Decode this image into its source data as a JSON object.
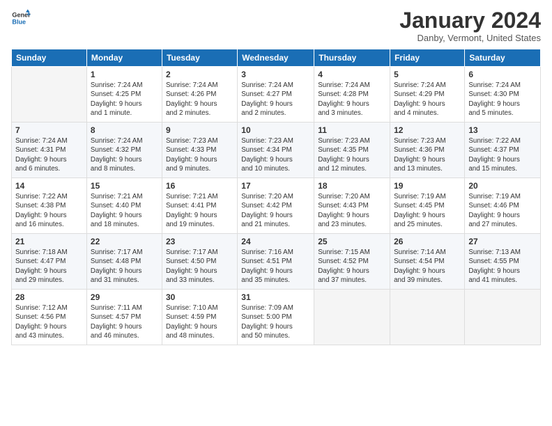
{
  "header": {
    "logo_line1": "General",
    "logo_line2": "Blue",
    "month_title": "January 2024",
    "location": "Danby, Vermont, United States"
  },
  "weekdays": [
    "Sunday",
    "Monday",
    "Tuesday",
    "Wednesday",
    "Thursday",
    "Friday",
    "Saturday"
  ],
  "rows": [
    [
      {
        "day": "",
        "text": ""
      },
      {
        "day": "1",
        "text": "Sunrise: 7:24 AM\nSunset: 4:25 PM\nDaylight: 9 hours\nand 1 minute."
      },
      {
        "day": "2",
        "text": "Sunrise: 7:24 AM\nSunset: 4:26 PM\nDaylight: 9 hours\nand 2 minutes."
      },
      {
        "day": "3",
        "text": "Sunrise: 7:24 AM\nSunset: 4:27 PM\nDaylight: 9 hours\nand 2 minutes."
      },
      {
        "day": "4",
        "text": "Sunrise: 7:24 AM\nSunset: 4:28 PM\nDaylight: 9 hours\nand 3 minutes."
      },
      {
        "day": "5",
        "text": "Sunrise: 7:24 AM\nSunset: 4:29 PM\nDaylight: 9 hours\nand 4 minutes."
      },
      {
        "day": "6",
        "text": "Sunrise: 7:24 AM\nSunset: 4:30 PM\nDaylight: 9 hours\nand 5 minutes."
      }
    ],
    [
      {
        "day": "7",
        "text": "Sunrise: 7:24 AM\nSunset: 4:31 PM\nDaylight: 9 hours\nand 6 minutes."
      },
      {
        "day": "8",
        "text": "Sunrise: 7:24 AM\nSunset: 4:32 PM\nDaylight: 9 hours\nand 8 minutes."
      },
      {
        "day": "9",
        "text": "Sunrise: 7:23 AM\nSunset: 4:33 PM\nDaylight: 9 hours\nand 9 minutes."
      },
      {
        "day": "10",
        "text": "Sunrise: 7:23 AM\nSunset: 4:34 PM\nDaylight: 9 hours\nand 10 minutes."
      },
      {
        "day": "11",
        "text": "Sunrise: 7:23 AM\nSunset: 4:35 PM\nDaylight: 9 hours\nand 12 minutes."
      },
      {
        "day": "12",
        "text": "Sunrise: 7:23 AM\nSunset: 4:36 PM\nDaylight: 9 hours\nand 13 minutes."
      },
      {
        "day": "13",
        "text": "Sunrise: 7:22 AM\nSunset: 4:37 PM\nDaylight: 9 hours\nand 15 minutes."
      }
    ],
    [
      {
        "day": "14",
        "text": "Sunrise: 7:22 AM\nSunset: 4:38 PM\nDaylight: 9 hours\nand 16 minutes."
      },
      {
        "day": "15",
        "text": "Sunrise: 7:21 AM\nSunset: 4:40 PM\nDaylight: 9 hours\nand 18 minutes."
      },
      {
        "day": "16",
        "text": "Sunrise: 7:21 AM\nSunset: 4:41 PM\nDaylight: 9 hours\nand 19 minutes."
      },
      {
        "day": "17",
        "text": "Sunrise: 7:20 AM\nSunset: 4:42 PM\nDaylight: 9 hours\nand 21 minutes."
      },
      {
        "day": "18",
        "text": "Sunrise: 7:20 AM\nSunset: 4:43 PM\nDaylight: 9 hours\nand 23 minutes."
      },
      {
        "day": "19",
        "text": "Sunrise: 7:19 AM\nSunset: 4:45 PM\nDaylight: 9 hours\nand 25 minutes."
      },
      {
        "day": "20",
        "text": "Sunrise: 7:19 AM\nSunset: 4:46 PM\nDaylight: 9 hours\nand 27 minutes."
      }
    ],
    [
      {
        "day": "21",
        "text": "Sunrise: 7:18 AM\nSunset: 4:47 PM\nDaylight: 9 hours\nand 29 minutes."
      },
      {
        "day": "22",
        "text": "Sunrise: 7:17 AM\nSunset: 4:48 PM\nDaylight: 9 hours\nand 31 minutes."
      },
      {
        "day": "23",
        "text": "Sunrise: 7:17 AM\nSunset: 4:50 PM\nDaylight: 9 hours\nand 33 minutes."
      },
      {
        "day": "24",
        "text": "Sunrise: 7:16 AM\nSunset: 4:51 PM\nDaylight: 9 hours\nand 35 minutes."
      },
      {
        "day": "25",
        "text": "Sunrise: 7:15 AM\nSunset: 4:52 PM\nDaylight: 9 hours\nand 37 minutes."
      },
      {
        "day": "26",
        "text": "Sunrise: 7:14 AM\nSunset: 4:54 PM\nDaylight: 9 hours\nand 39 minutes."
      },
      {
        "day": "27",
        "text": "Sunrise: 7:13 AM\nSunset: 4:55 PM\nDaylight: 9 hours\nand 41 minutes."
      }
    ],
    [
      {
        "day": "28",
        "text": "Sunrise: 7:12 AM\nSunset: 4:56 PM\nDaylight: 9 hours\nand 43 minutes."
      },
      {
        "day": "29",
        "text": "Sunrise: 7:11 AM\nSunset: 4:57 PM\nDaylight: 9 hours\nand 46 minutes."
      },
      {
        "day": "30",
        "text": "Sunrise: 7:10 AM\nSunset: 4:59 PM\nDaylight: 9 hours\nand 48 minutes."
      },
      {
        "day": "31",
        "text": "Sunrise: 7:09 AM\nSunset: 5:00 PM\nDaylight: 9 hours\nand 50 minutes."
      },
      {
        "day": "",
        "text": ""
      },
      {
        "day": "",
        "text": ""
      },
      {
        "day": "",
        "text": ""
      }
    ]
  ]
}
